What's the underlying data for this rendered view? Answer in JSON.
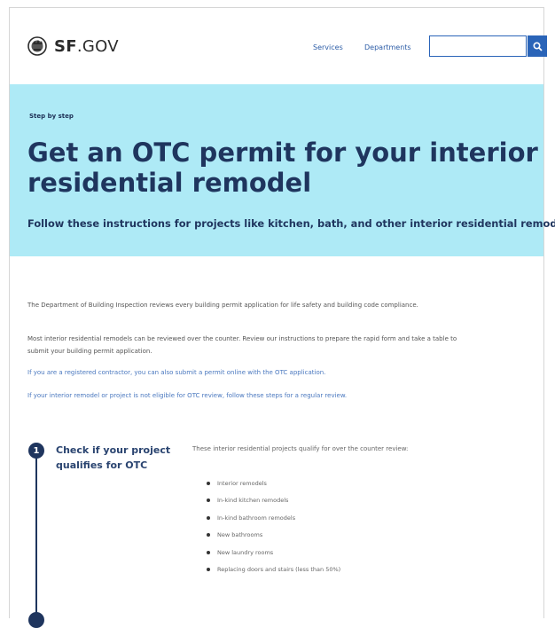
{
  "header": {
    "logo_bold": "SF",
    "logo_rest": ".GOV",
    "nav": [
      "Services",
      "Departments"
    ],
    "search": {
      "placeholder": "",
      "button_icon": "search-icon"
    }
  },
  "hero": {
    "eyebrow": "Step by step",
    "title": "Get an OTC permit for your interior residential remodel",
    "subtitle": "Follow these instructions for projects like kitchen, bath, and other interior residential remodels."
  },
  "intro": [
    "The Department of Building Inspection reviews every building permit application for life safety and building code compliance.",
    "Most interior residential remodels can be reviewed over the counter. Review our instructions to prepare the rapid form and take a table to submit your building permit application.",
    "If you are a registered contractor, you can also submit a permit online with the OTC application.",
    "If your interior remodel or project is not eligible for OTC review, follow these steps for a regular review."
  ],
  "steps": [
    {
      "number": "1",
      "title": "Check if your project qualifies for OTC",
      "description": "These interior residential projects qualify for over the counter review:",
      "items": [
        "Interior remodels",
        "In-kind kitchen remodels",
        "In-kind bathroom remodels",
        "New bathrooms",
        "New laundry rooms",
        "Replacing doors and stairs (less than 50%)"
      ]
    }
  ],
  "colors": {
    "accent": "#2a64b8",
    "hero_bg": "#aeeaf6",
    "heading": "#1f355e"
  }
}
